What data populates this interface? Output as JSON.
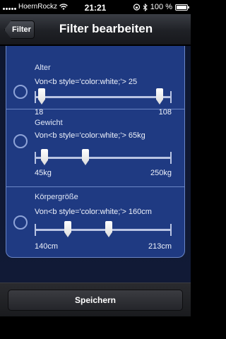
{
  "status_bar": {
    "carrier": "HoernRockz",
    "time": "21:21",
    "battery_percent": "100 %",
    "battery_level": 1.0
  },
  "nav": {
    "back_label": "Filter",
    "title": "Filter bearbeiten"
  },
  "filters": [
    {
      "label": "Alter",
      "value_text": "Von<b style='color:white;'> 25",
      "min_label": "18",
      "max_label": "108",
      "thumbs": [
        0.05,
        0.91
      ]
    },
    {
      "label": "Gewicht",
      "value_text": "Von<b style='color:white;'> 65kg",
      "min_label": "45kg",
      "max_label": "250kg",
      "thumbs": [
        0.07,
        0.37
      ]
    },
    {
      "label": "Körpergröße",
      "value_text": "Von<b style='color:white;'> 160cm",
      "min_label": "140cm",
      "max_label": "213cm",
      "thumbs": [
        0.24,
        0.54
      ]
    }
  ],
  "footer": {
    "save_label": "Speichern"
  }
}
